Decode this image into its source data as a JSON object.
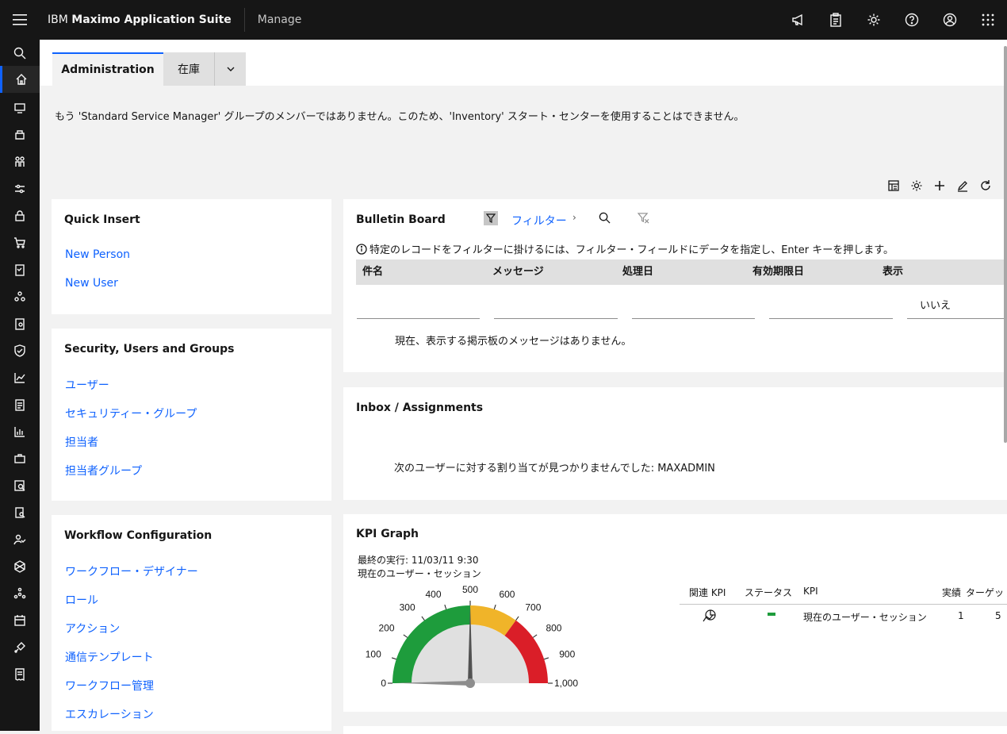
{
  "header": {
    "brand_prefix": "IBM",
    "brand_product": "Maximo Application Suite",
    "module": "Manage",
    "icons": [
      "megaphone-icon",
      "clipboard-icon",
      "gear-icon",
      "help-icon",
      "user-icon",
      "app-switcher-icon"
    ]
  },
  "leftnav": {
    "icons": [
      "search-icon",
      "home-icon",
      "monitor-icon",
      "assets-icon",
      "people-icon",
      "settings-sliders-icon",
      "lock-icon",
      "cart-icon",
      "checklist-icon",
      "network-icon",
      "clipboard-person-icon",
      "shield-icon",
      "chart-line-icon",
      "report-icon",
      "bar-chart-icon",
      "toolbox-icon",
      "inspection-icon",
      "document-search-icon",
      "user-check-icon",
      "hexagon-icon",
      "flow-icon",
      "calendar-icon",
      "satellite-icon",
      "receipt-icon"
    ]
  },
  "tabs": {
    "active": "Administration",
    "inactive": "在庫"
  },
  "notice": "もう 'Standard Service Manager' グループのメンバーではありません。このため、'Inventory' スタート・センターを使用することはできません。",
  "quick_insert": {
    "title": "Quick Insert",
    "links": [
      "New Person",
      "New User"
    ]
  },
  "security": {
    "title": "Security, Users and Groups",
    "links": [
      "ユーザー",
      "セキュリティー・グループ",
      "担当者",
      "担当者グループ"
    ]
  },
  "workflow": {
    "title": "Workflow Configuration",
    "links": [
      "ワークフロー・デザイナー",
      "ロール",
      "アクション",
      "通信テンプレート",
      "ワークフロー管理",
      "エスカレーション"
    ]
  },
  "bulletin": {
    "title": "Bulletin Board",
    "filter_label": "フィルター",
    "info": "特定のレコードをフィルターに掛けるには、フィルター・フィールドにデータを指定し、Enter キーを押します。",
    "columns": [
      "件名",
      "メッセージ",
      "処理日",
      "有効期限日",
      "表示"
    ],
    "display_filter_value": "いいえ",
    "empty": "現在、表示する掲示板のメッセージはありません。"
  },
  "inbox": {
    "title": "Inbox / Assignments",
    "empty": "次のユーザーに対する割り当てが見つかりませんでした: MAXADMIN"
  },
  "kpi": {
    "title": "KPI Graph",
    "last_run": "最終の実行: 11/03/11 9:30",
    "subtitle": "現在のユーザー・セッション",
    "gauge_ticks": [
      "0",
      "100",
      "200",
      "300",
      "400",
      "500",
      "600",
      "700",
      "800",
      "900",
      "1,000"
    ],
    "gauge_value": 1,
    "gauge_max": 1000,
    "colors": {
      "green": "#1e9c3c",
      "yellow": "#f0b429",
      "red": "#da1e28"
    },
    "table_headers": [
      "関連 KPI",
      "ステータス",
      "KPI",
      "実績",
      "ターゲット"
    ],
    "row": {
      "kpi": "現在のユーザー・セッション",
      "actual": "1",
      "target": "5"
    }
  }
}
